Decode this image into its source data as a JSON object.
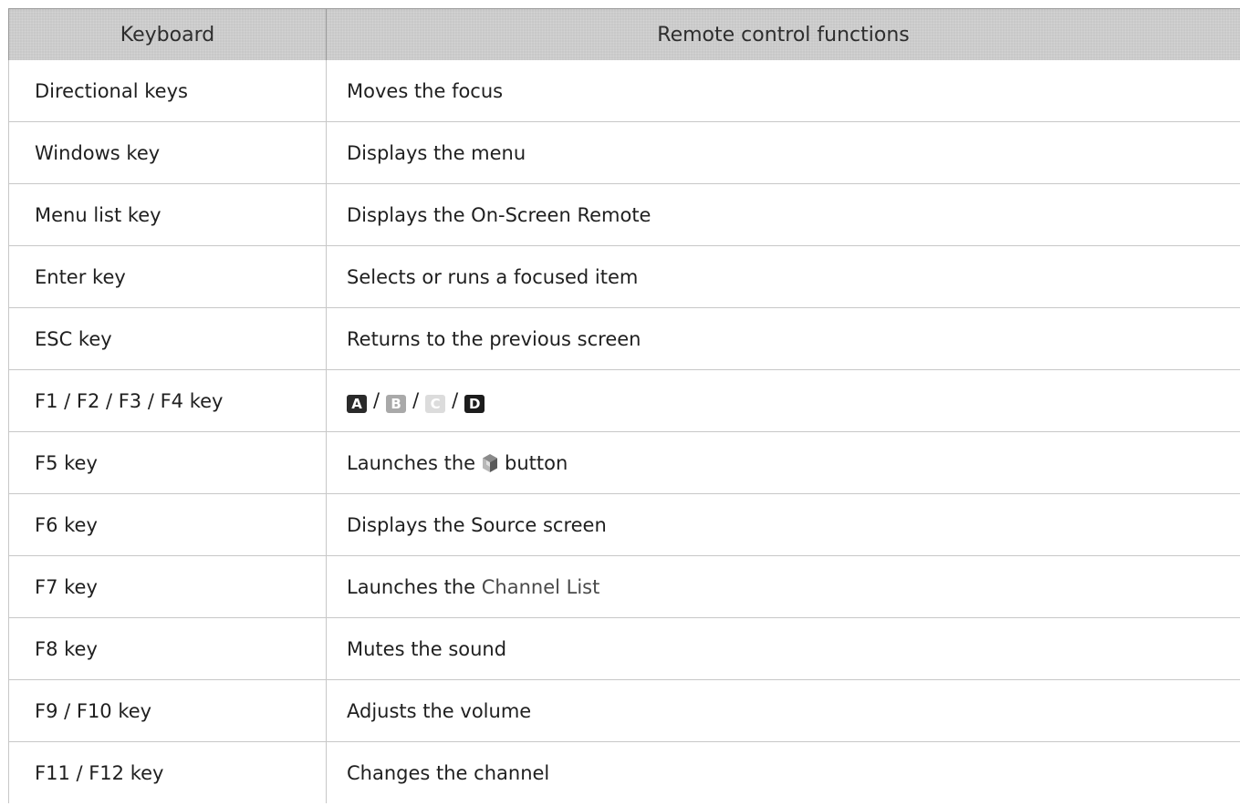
{
  "header": {
    "col_keyboard": "Keyboard",
    "col_functions": "Remote control functions"
  },
  "rows": [
    {
      "key": "Directional keys",
      "function": "Moves the focus"
    },
    {
      "key": "Windows key",
      "function": "Displays the menu"
    },
    {
      "key": "Menu list key",
      "function": "Displays the On-Screen Remote"
    },
    {
      "key": "Enter key",
      "function": "Selects or runs a focused item"
    },
    {
      "key": "ESC key",
      "function": "Returns to the previous screen"
    },
    {
      "key": "F1 / F2 / F3 / F4 key",
      "color_keys": [
        {
          "letter": "A",
          "bg": "#2a2a2a",
          "fg": "#ffffff"
        },
        {
          "letter": "B",
          "bg": "#a9a9a9",
          "fg": "#ffffff"
        },
        {
          "letter": "C",
          "bg": "#dcdcdc",
          "fg": "#ffffff"
        },
        {
          "letter": "D",
          "bg": "#1c1c1c",
          "fg": "#ffffff"
        }
      ],
      "separator": "/"
    },
    {
      "key": "F5 key",
      "function_before": "Launches the",
      "icon": "smart-hub-icon",
      "function_after": "button"
    },
    {
      "key": "F6 key",
      "function": "Displays the Source screen"
    },
    {
      "key": "F7 key",
      "function_before": "Launches the",
      "function_highlight": "Channel List"
    },
    {
      "key": "F8 key",
      "function": "Mutes the sound"
    },
    {
      "key": "F9 / F10 key",
      "function": "Adjusts the volume"
    },
    {
      "key": "F11 / F12 key",
      "function": "Changes the channel"
    }
  ]
}
